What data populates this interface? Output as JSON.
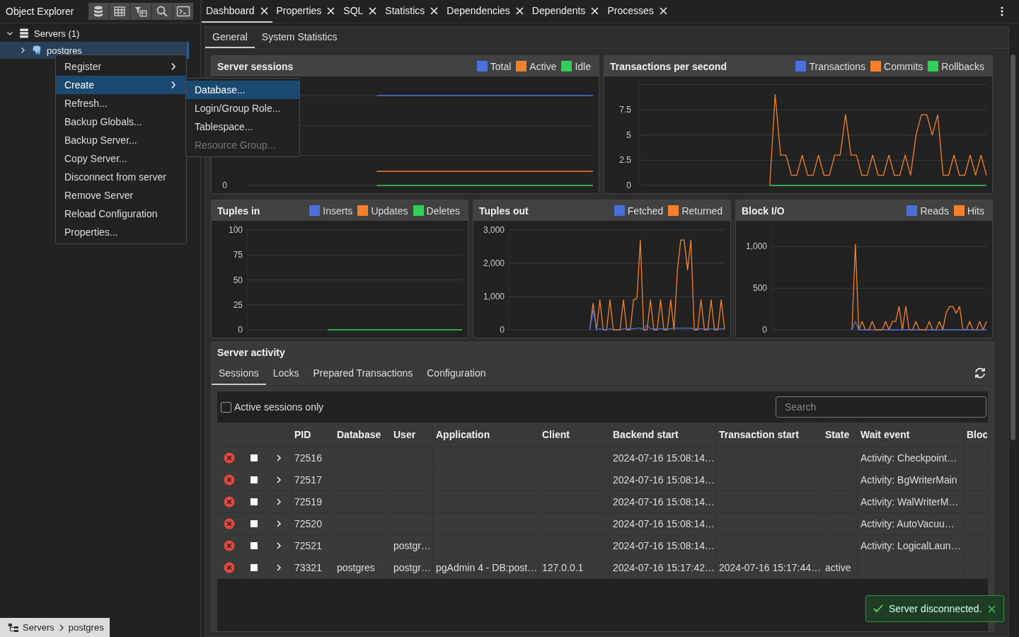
{
  "sidebar": {
    "title": "Object Explorer",
    "tree": [
      {
        "label": "Servers (1)",
        "expanded": true,
        "selected": false,
        "children": [
          {
            "label": "postgres",
            "expanded": false,
            "selected": true
          }
        ]
      }
    ],
    "breadcrumb": [
      "Servers",
      "postgres"
    ]
  },
  "context_menu": {
    "items": [
      {
        "label": "Register",
        "submenu": true,
        "selected": false
      },
      {
        "label": "Create",
        "submenu": true,
        "selected": true
      },
      {
        "label": "Refresh...",
        "submenu": false,
        "selected": false
      },
      {
        "label": "Backup Globals...",
        "submenu": false,
        "selected": false
      },
      {
        "label": "Backup Server...",
        "submenu": false,
        "selected": false
      },
      {
        "label": "Copy Server...",
        "submenu": false,
        "selected": false
      },
      {
        "label": "Disconnect from server",
        "submenu": false,
        "selected": false
      },
      {
        "label": "Remove Server",
        "submenu": false,
        "selected": false
      },
      {
        "label": "Reload Configuration",
        "submenu": false,
        "selected": false
      },
      {
        "label": "Properties...",
        "submenu": false,
        "selected": false
      }
    ]
  },
  "submenu": {
    "items": [
      {
        "label": "Database...",
        "selected": true,
        "disabled": false
      },
      {
        "label": "Login/Group Role...",
        "selected": false,
        "disabled": false
      },
      {
        "label": "Tablespace...",
        "selected": false,
        "disabled": false
      },
      {
        "label": "Resource Group...",
        "selected": false,
        "disabled": true
      }
    ]
  },
  "tabs": [
    {
      "label": "Dashboard",
      "selected": true
    },
    {
      "label": "Properties",
      "selected": false
    },
    {
      "label": "SQL",
      "selected": false
    },
    {
      "label": "Statistics",
      "selected": false
    },
    {
      "label": "Dependencies",
      "selected": false
    },
    {
      "label": "Dependents",
      "selected": false
    },
    {
      "label": "Processes",
      "selected": false
    }
  ],
  "dashboard_tabs": [
    {
      "label": "General",
      "selected": true
    },
    {
      "label": "System Statistics",
      "selected": false
    }
  ],
  "server_sessions": {
    "title": "Server sessions",
    "axis_label": "0",
    "legend": [
      {
        "name": "Total",
        "color": "#4a70dc"
      },
      {
        "name": "Active",
        "color": "#f5822a"
      },
      {
        "name": "Idle",
        "color": "#31d158"
      }
    ]
  },
  "charts": [
    {
      "chart_data": {
        "type": "line",
        "title": "Transactions per second",
        "grid": true,
        "ylim": [
          0,
          10.8
        ],
        "yticks": [
          0,
          2.5,
          5,
          7.5
        ],
        "series": [
          {
            "name": "Transactions",
            "color": "#4a70dc",
            "values": [
              null,
              null,
              null,
              null,
              null,
              null,
              null,
              null,
              null,
              null,
              null,
              null,
              null,
              null,
              null,
              null,
              null,
              null,
              null,
              null,
              null,
              null,
              null,
              null,
              null,
              null,
              null,
              null,
              null,
              null,
              null,
              null,
              null,
              null,
              null,
              null,
              null,
              null,
              null,
              null,
              null,
              null,
              null,
              null,
              null,
              null,
              null,
              null,
              null,
              null,
              null,
              null,
              null,
              null,
              null,
              null,
              null,
              null,
              null,
              null,
              null,
              null,
              null,
              null,
              null
            ]
          },
          {
            "name": "Commits",
            "color": "#f5822a",
            "values": [
              null,
              null,
              null,
              null,
              null,
              null,
              null,
              null,
              null,
              null,
              null,
              null,
              null,
              null,
              null,
              null,
              null,
              null,
              null,
              null,
              null,
              null,
              null,
              null,
              0,
              9,
              3,
              3,
              1,
              1,
              3,
              1,
              1,
              3,
              1,
              1,
              3,
              3,
              7,
              3,
              3,
              1,
              1,
              3,
              1,
              1,
              3,
              1,
              1,
              3,
              1,
              5,
              7,
              7,
              5,
              7,
              1,
              1,
              3,
              1,
              1,
              3,
              1,
              3,
              1
            ]
          },
          {
            "name": "Rollbacks",
            "color": "#31d158",
            "values": [
              null,
              null,
              null,
              null,
              null,
              null,
              null,
              null,
              null,
              null,
              null,
              null,
              null,
              null,
              null,
              null,
              null,
              null,
              null,
              null,
              null,
              null,
              null,
              null,
              0,
              0,
              0,
              0,
              0,
              0,
              0,
              0,
              0,
              0,
              0,
              0,
              0,
              0,
              0,
              0,
              0,
              0,
              0,
              0,
              0,
              0,
              0,
              0,
              0,
              0,
              0,
              0,
              0,
              0,
              0,
              0,
              0,
              0,
              0,
              0,
              0,
              0,
              0,
              0,
              0
            ]
          }
        ]
      }
    },
    {
      "chart_data": {
        "type": "line",
        "title": "Tuples in",
        "grid": true,
        "ylim": [
          0,
          100
        ],
        "yticks": [
          0,
          25,
          50,
          75,
          100
        ],
        "series": [
          {
            "name": "Inserts",
            "color": "#4a70dc",
            "values": [
              null,
              null,
              null,
              null,
              null,
              null,
              null,
              null,
              null,
              null,
              null,
              null,
              null,
              null,
              null,
              null,
              null,
              null,
              null,
              null,
              null,
              null,
              null,
              null,
              null,
              null,
              null,
              null,
              null,
              null,
              null,
              null,
              null,
              null,
              null,
              null,
              null,
              null,
              null,
              null,
              null,
              null,
              null,
              null,
              null,
              null,
              null,
              null,
              null,
              null,
              null,
              null,
              null,
              null,
              null,
              null,
              null,
              null,
              null,
              null,
              null,
              null,
              null,
              null,
              null
            ]
          },
          {
            "name": "Updates",
            "color": "#f5822a",
            "values": [
              null,
              null,
              null,
              null,
              null,
              null,
              null,
              null,
              null,
              null,
              null,
              null,
              null,
              null,
              null,
              null,
              null,
              null,
              null,
              null,
              null,
              null,
              null,
              null,
              null,
              null,
              null,
              null,
              null,
              null,
              null,
              null,
              null,
              null,
              null,
              null,
              null,
              null,
              null,
              null,
              null,
              null,
              null,
              null,
              null,
              null,
              null,
              null,
              null,
              null,
              null,
              null,
              null,
              null,
              null,
              null,
              null,
              null,
              null,
              null,
              null,
              null,
              null,
              null,
              null
            ]
          },
          {
            "name": "Deletes",
            "color": "#31d158",
            "values": [
              null,
              null,
              null,
              null,
              null,
              null,
              null,
              null,
              null,
              null,
              null,
              null,
              null,
              null,
              null,
              null,
              null,
              null,
              null,
              null,
              null,
              null,
              null,
              null,
              0,
              0,
              0,
              0,
              0,
              0,
              0,
              0,
              0,
              0,
              0,
              0,
              0,
              0,
              0,
              0,
              0,
              0,
              0,
              0,
              0,
              0,
              0,
              0,
              0,
              0,
              0,
              0,
              0,
              0,
              0,
              0,
              0,
              0,
              0,
              0,
              0,
              0,
              0,
              0,
              0
            ]
          }
        ]
      }
    },
    {
      "chart_data": {
        "type": "line",
        "title": "Tuples out",
        "grid": true,
        "ylim": [
          0,
          3000
        ],
        "yticks": [
          0,
          {
            "value": 1000,
            "label": "1,000"
          },
          {
            "value": 2000,
            "label": "2,000"
          },
          {
            "value": 3000,
            "label": "3,000"
          }
        ],
        "series": [
          {
            "name": "Fetched",
            "color": "#4a70dc",
            "values": [
              null,
              null,
              null,
              null,
              null,
              null,
              null,
              null,
              null,
              null,
              null,
              null,
              null,
              null,
              null,
              null,
              null,
              null,
              null,
              null,
              null,
              null,
              null,
              null,
              0,
              600,
              0,
              30,
              0,
              0,
              30,
              0,
              null,
              0,
              30,
              30,
              30,
              30,
              50,
              50,
              0,
              150,
              30,
              30,
              30,
              30,
              30,
              30,
              30,
              50,
              50,
              50,
              50,
              50,
              50,
              30,
              30,
              30,
              30,
              30,
              30,
              30,
              30,
              30,
              30
            ]
          },
          {
            "name": "Returned",
            "color": "#f5822a",
            "values": [
              null,
              null,
              null,
              null,
              null,
              null,
              null,
              null,
              null,
              null,
              null,
              null,
              null,
              null,
              null,
              null,
              null,
              null,
              null,
              null,
              null,
              null,
              null,
              null,
              0,
              800,
              0,
              900,
              0,
              0,
              900,
              0,
              0,
              0,
              900,
              0,
              0,
              900,
              950,
              2700,
              0,
              0,
              900,
              0,
              0,
              900,
              0,
              0,
              900,
              0,
              1800,
              2700,
              2700,
              1800,
              2700,
              0,
              0,
              900,
              0,
              0,
              900,
              0,
              0,
              900,
              0
            ]
          }
        ]
      }
    },
    {
      "chart_data": {
        "type": "line",
        "title": "Block I/O",
        "grid": true,
        "ylim": [
          0,
          1310
        ],
        "yticks": [
          0,
          500,
          {
            "value": 1000,
            "label": "1,000"
          }
        ],
        "series": [
          {
            "name": "Reads",
            "color": "#4a70dc",
            "values": [
              null,
              null,
              null,
              null,
              null,
              null,
              null,
              null,
              null,
              null,
              null,
              null,
              null,
              null,
              null,
              null,
              null,
              null,
              null,
              null,
              null,
              null,
              null,
              null,
              0,
              100,
              0,
              0,
              0,
              0,
              0,
              0,
              null,
              0,
              0,
              0,
              0,
              0,
              0,
              0,
              0,
              0,
              0,
              0,
              0,
              null,
              0,
              0,
              0,
              0,
              0,
              0,
              0,
              0,
              0,
              0,
              0,
              0,
              0,
              0,
              0,
              0,
              0,
              0,
              0
            ]
          },
          {
            "name": "Hits",
            "color": "#f5822a",
            "values": [
              null,
              null,
              null,
              null,
              null,
              null,
              null,
              null,
              null,
              null,
              null,
              null,
              null,
              null,
              null,
              null,
              null,
              null,
              null,
              null,
              null,
              null,
              null,
              null,
              0,
              1030,
              0,
              100,
              0,
              0,
              100,
              0,
              0,
              0,
              100,
              0,
              100,
              100,
              280,
              0,
              280,
              0,
              0,
              100,
              0,
              0,
              0,
              100,
              0,
              0,
              100,
              0,
              200,
              280,
              280,
              200,
              280,
              0,
              0,
              100,
              0,
              0,
              100,
              0,
              100
            ]
          }
        ]
      }
    }
  ],
  "server_activity": {
    "title": "Server activity",
    "tabs": [
      {
        "label": "Sessions",
        "selected": true
      },
      {
        "label": "Locks",
        "selected": false
      },
      {
        "label": "Prepared Transactions",
        "selected": false
      },
      {
        "label": "Configuration",
        "selected": false
      }
    ],
    "active_sessions_only": {
      "label": "Active sessions only",
      "checked": false
    },
    "search": {
      "placeholder": "Search"
    },
    "columns": [
      "PID",
      "Database",
      "User",
      "Application",
      "Client",
      "Backend start",
      "Transaction start",
      "State",
      "Wait event",
      "Bloc"
    ],
    "rows": [
      [
        "72516",
        "",
        "",
        "",
        "",
        "2024-07-16 15:08:14…",
        "",
        "",
        "Activity: Checkpoint…"
      ],
      [
        "72517",
        "",
        "",
        "",
        "",
        "2024-07-16 15:08:14…",
        "",
        "",
        "Activity: BgWriterMain"
      ],
      [
        "72519",
        "",
        "",
        "",
        "",
        "2024-07-16 15:08:14…",
        "",
        "",
        "Activity: WalWriterM…"
      ],
      [
        "72520",
        "",
        "",
        "",
        "",
        "2024-07-16 15:08:14…",
        "",
        "",
        "Activity: AutoVacuu…"
      ],
      [
        "72521",
        "",
        "postgr…",
        "",
        "",
        "2024-07-16 15:08:14…",
        "",
        "",
        "Activity: LogicalLaun…"
      ],
      [
        "73321",
        "postgres",
        "postgr…",
        "pgAdmin 4 - DB:post…",
        "127.0.0.1",
        "2024-07-16 15:17:42…",
        "2024-07-16 15:17:44…",
        "active",
        ""
      ]
    ]
  },
  "toast": {
    "message": "Server disconnected."
  }
}
